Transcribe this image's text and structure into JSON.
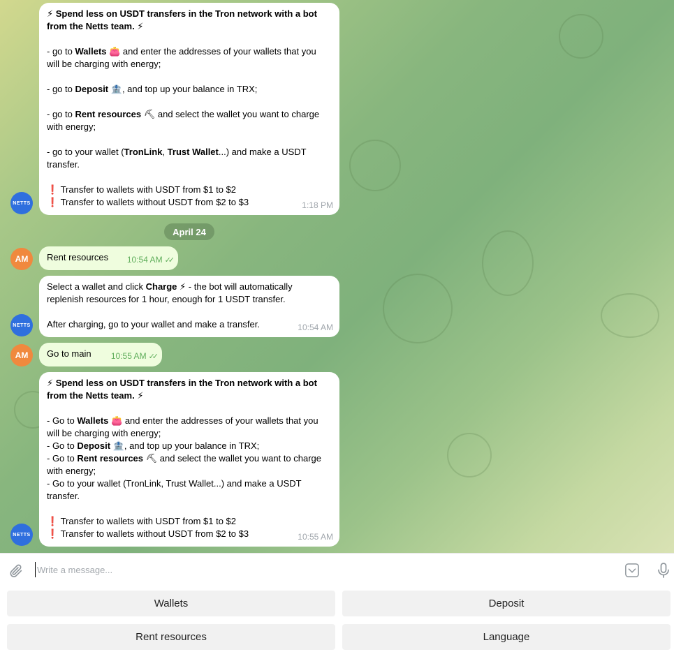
{
  "colors": {
    "accent": "#2f6fde",
    "user_avatar": "#f0893e",
    "out_bubble": "#effdde",
    "check": "#5fae5b"
  },
  "avatars": {
    "bot": "NETTS",
    "user": "AM"
  },
  "date_separator": "April 24",
  "messages": [
    {
      "id": "m1",
      "time": "1:18 PM",
      "title_a": "Spend less on USDT transfers in the Tron network with a bot",
      "title_b": "from the Netts team.",
      "l1a": "- go to ",
      "l1b": "Wallets",
      "l1c": " and enter the addresses of your wallets that you",
      "l1d": "will be charging with energy;",
      "l2a": "- go to ",
      "l2b": "Deposit",
      "l2c": ", and top up your balance in TRX;",
      "l3a": "- go to ",
      "l3b": "Rent resources",
      "l3c": " and select the wallet you want to charge",
      "l3d": "with energy;",
      "l4a": "- go to your wallet (",
      "l4b": "TronLink",
      "l4c": ", ",
      "l4d": "Trust Wallet",
      "l4e": "...) and make a USDT",
      "l4f": "transfer.",
      "w1": "Transfer to wallets with USDT from $1 to $2",
      "w2": "Transfer to wallets without USDT from $2 to $3"
    },
    {
      "id": "m2",
      "text": "Rent resources",
      "time": "10:54 AM"
    },
    {
      "id": "m3",
      "time": "10:54 AM",
      "l1a": "Select a wallet and click ",
      "l1b": "Charge",
      "l1c": " - the bot will automatically",
      "l1d": "replenish resources for 1 hour, enough for 1 USDT transfer.",
      "l2": "After charging, go to your wallet and make a transfer."
    },
    {
      "id": "m4",
      "text": "Go to main",
      "time": "10:55 AM"
    },
    {
      "id": "m5",
      "time": "10:55 AM",
      "title_a": "Spend less on USDT transfers in the Tron network with a bot",
      "title_b": "from the Netts team.",
      "l1a": "- Go to ",
      "l1b": "Wallets",
      "l1c": " and enter the addresses of your wallets that you",
      "l1d": "will be charging with energy;",
      "l2a": "- Go to ",
      "l2b": "Deposit",
      "l2c": ", and top up your balance in TRX;",
      "l3a": "- Go to ",
      "l3b": "Rent resources",
      "l3c": " and select the wallet you want to charge",
      "l3d": "with energy;",
      "l4a": "- Go to your wallet (TronLink, Trust Wallet...) and make a USDT",
      "l4b": "transfer.",
      "w1": "Transfer to wallets with USDT from $1 to $2",
      "w2": "Transfer to wallets without USDT from $2 to $3"
    }
  ],
  "composer": {
    "placeholder": "Write a message..."
  },
  "keyboard": [
    {
      "label": "Wallets"
    },
    {
      "label": "Deposit"
    },
    {
      "label": "Rent resources"
    },
    {
      "label": "Language"
    }
  ]
}
